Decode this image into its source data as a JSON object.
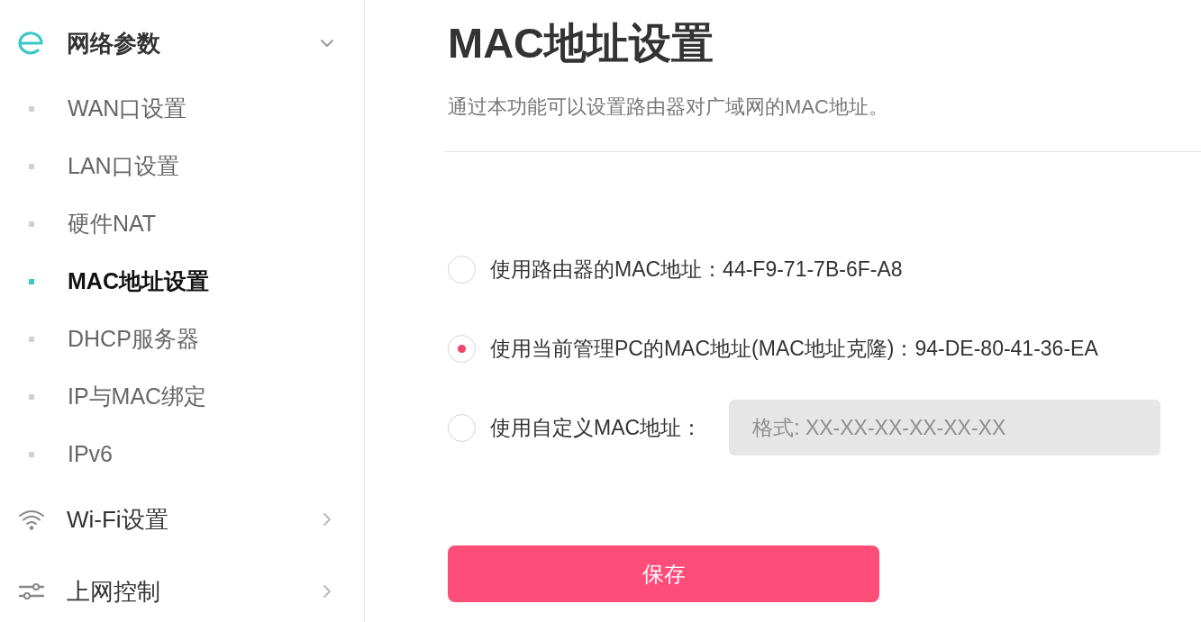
{
  "sidebar": {
    "groups": [
      {
        "label": "网络参数",
        "expanded": true,
        "children": [
          {
            "label": "WAN口设置",
            "selected": false
          },
          {
            "label": "LAN口设置",
            "selected": false
          },
          {
            "label": "硬件NAT",
            "selected": false
          },
          {
            "label": "MAC地址设置",
            "selected": true
          },
          {
            "label": "DHCP服务器",
            "selected": false
          },
          {
            "label": "IP与MAC绑定",
            "selected": false
          },
          {
            "label": "IPv6",
            "selected": false
          }
        ]
      },
      {
        "label": "Wi-Fi设置",
        "expanded": false
      },
      {
        "label": "上网控制",
        "expanded": false
      }
    ]
  },
  "page": {
    "title": "MAC地址设置",
    "description": "通过本功能可以设置路由器对广域网的MAC地址。"
  },
  "options": [
    {
      "kind": "text",
      "label": "使用路由器的MAC地址：44-F9-71-7B-6F-A8",
      "selected": false
    },
    {
      "kind": "text",
      "label": "使用当前管理PC的MAC地址(MAC地址克隆)：94-DE-80-41-36-EA",
      "selected": true
    },
    {
      "kind": "input",
      "label": "使用自定义MAC地址：",
      "selected": false,
      "field": {
        "placeholder": "格式: XX-XX-XX-XX-XX-XX",
        "disabled": true
      }
    }
  ],
  "save_button": {
    "label": "保存"
  }
}
